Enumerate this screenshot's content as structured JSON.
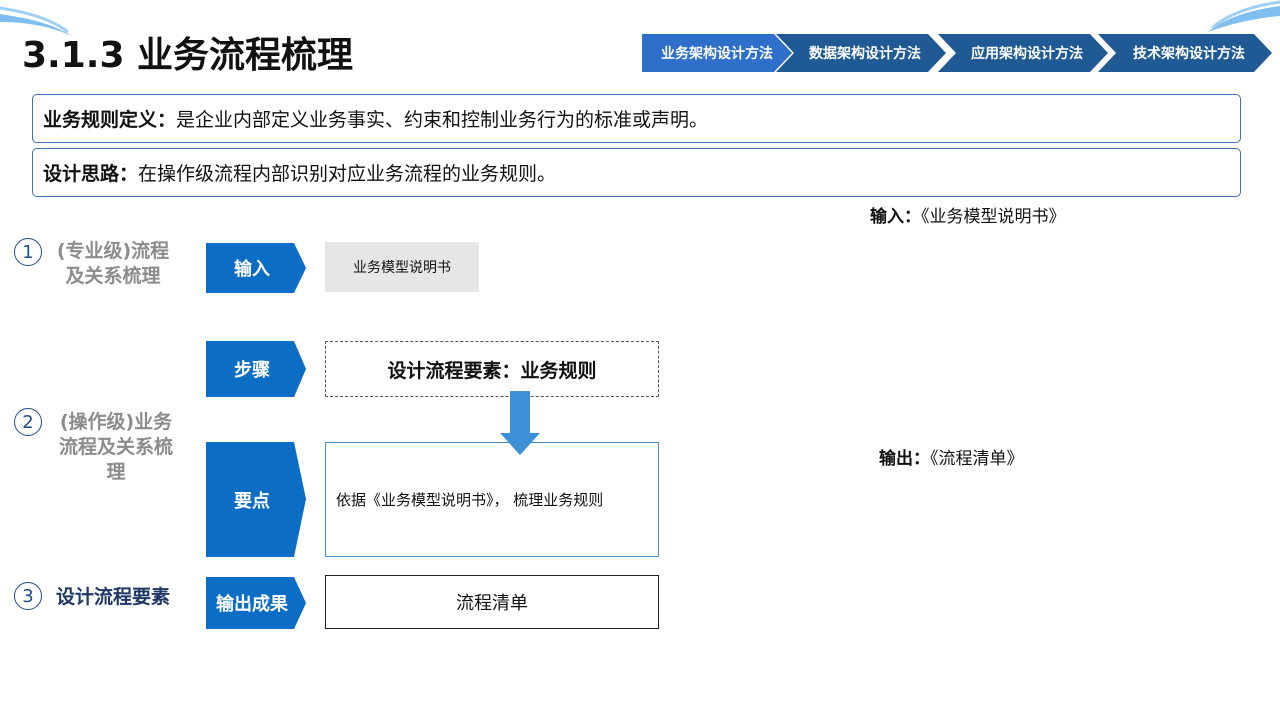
{
  "header": {
    "title": "3.1.3 业务流程梳理"
  },
  "nav": {
    "tabs": [
      {
        "label": "业务架构设计方法",
        "active": true
      },
      {
        "label": "数据架构设计方法",
        "active": false
      },
      {
        "label": "应用架构设计方法",
        "active": false
      },
      {
        "label": "技术架构设计方法",
        "active": false
      }
    ]
  },
  "definitions": {
    "rule_label": "业务规则定义：",
    "rule_text": "是企业内部定义业务事实、约束和控制业务行为的标准或声明。",
    "idea_label": "设计思路：",
    "idea_text": "在操作级流程内部识别对应业务流程的业务规则。"
  },
  "phases": [
    {
      "number": "1",
      "label": "(专业级)流程及关系梳理"
    },
    {
      "number": "2",
      "label": "(操作级)业务流程及关系梳理"
    },
    {
      "number": "3",
      "label": "设计流程要素"
    }
  ],
  "flow": {
    "input_label": "输入",
    "input_value": "业务模型说明书",
    "step_label": "步骤",
    "step_value": "设计流程要素：业务规则",
    "key_label": "要点",
    "key_value": "依据《业务模型说明书》，  梳理业务规则",
    "output_label": "输出成果",
    "output_value": "流程清单"
  },
  "notes": {
    "input_label": "输入：",
    "input_value": "《业务模型说明书》",
    "output_label": "输出：",
    "output_value": "《流程清单》"
  },
  "colors": {
    "primary": "#0b6ec4",
    "nav_active": "#2e6fc9",
    "nav_inactive": "#1f5a94",
    "arrow": "#3d8fd6",
    "gray_text": "#8c8c8c",
    "navy_text": "#1f3864"
  }
}
